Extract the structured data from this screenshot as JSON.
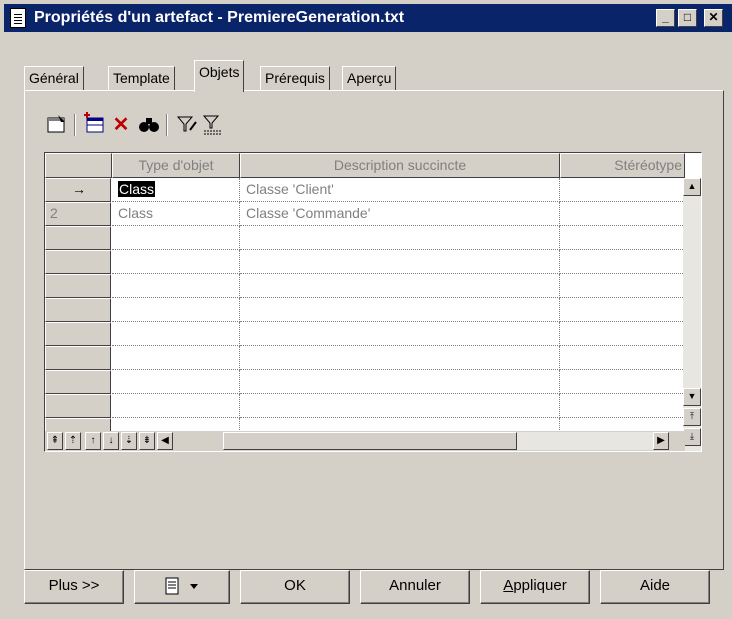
{
  "window": {
    "title": "Propriétés d'un artefact - PremiereGeneration.txt",
    "minimize": "_",
    "maximize": "□",
    "close": "✕"
  },
  "tabs": [
    {
      "label": "Général",
      "active": false
    },
    {
      "label": "Template",
      "active": false
    },
    {
      "label": "Objets",
      "active": true
    },
    {
      "label": "Prérequis",
      "active": false
    },
    {
      "label": "Aperçu",
      "active": false
    }
  ],
  "toolbar": {
    "icons": [
      "properties-icon",
      "add-objects-icon",
      "delete-icon",
      "find-icon",
      "filter-icon",
      "filter-clear-icon"
    ]
  },
  "grid": {
    "columns": [
      "",
      "Type d'objet",
      "Description succincte",
      "Stéréotype"
    ],
    "rows": [
      {
        "header": "→",
        "type": "Class",
        "description": "Classe 'Client'",
        "stereotype": "",
        "current": true
      },
      {
        "header": "2",
        "type": "Class",
        "description": "Classe 'Commande'",
        "stereotype": "",
        "current": false
      }
    ],
    "empty_rows": 9
  },
  "buttons": {
    "more": "Plus >>",
    "ok": "OK",
    "cancel": "Annuler",
    "apply_underlined": "A",
    "apply_rest": "ppliquer",
    "help": "Aide"
  },
  "colors": {
    "titlebar": "#0a246a",
    "face": "#d4d0c8"
  }
}
